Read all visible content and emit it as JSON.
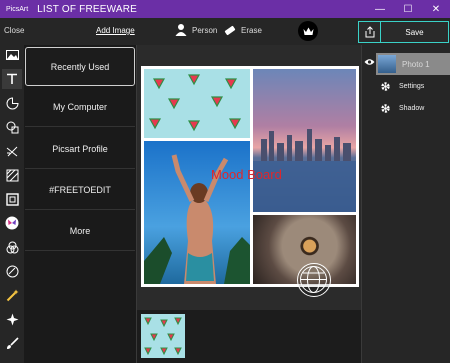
{
  "window": {
    "app_name": "PicsArt",
    "title": "LIST OF FREEWARE",
    "controls": [
      "—",
      "☐",
      "✕"
    ]
  },
  "toolbar": {
    "close_label": "Close",
    "add_image_label": "Add Image",
    "person_label": "Person",
    "erase_label": "Erase",
    "save_label": "Save"
  },
  "rail": {
    "icons": [
      "gallery-icon",
      "text-icon",
      "sticker-icon",
      "shapes-icon",
      "crop-icon",
      "background-icon",
      "frame-icon",
      "butterfly-icon",
      "blend-icon",
      "draw-icon",
      "magic-wand-icon",
      "sparkle-icon",
      "brush-icon",
      "edit-icon"
    ]
  },
  "sources": {
    "items": [
      "Recently Used",
      "My Computer",
      "Picsart Profile",
      "#FREETOEDIT",
      "More"
    ],
    "selected_index": 0
  },
  "canvas": {
    "board_title": "Mood Board"
  },
  "layers": {
    "layer_name": "Photo 1",
    "settings_label": "Settings",
    "shadow_label": "Shadow"
  },
  "colors": {
    "titlebar": "#6b2fa6",
    "accent": "#3ad2c8",
    "board_title": "#e0262b"
  }
}
